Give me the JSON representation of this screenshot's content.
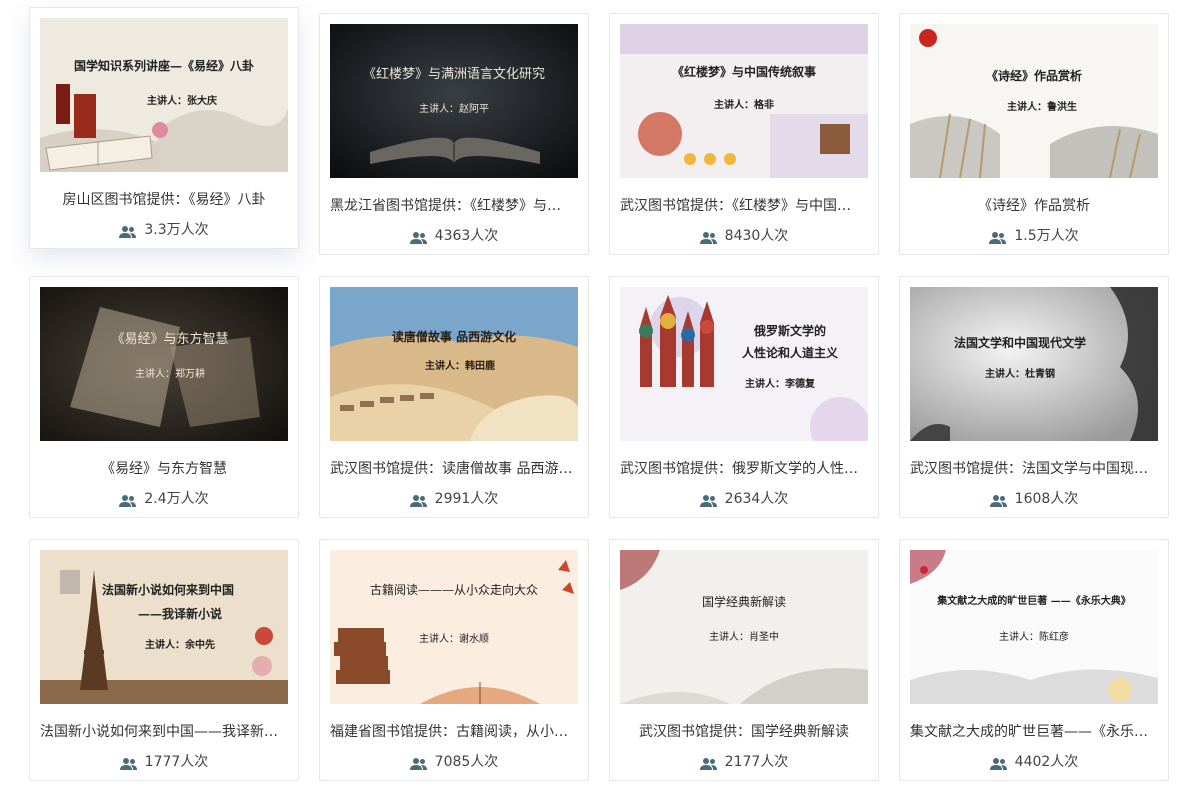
{
  "cards": [
    {
      "title": "房山区图书馆提供：《易经》八卦",
      "views": "3.3万人次",
      "thumb": {
        "line1": "国学知识系列讲座—《易经》八卦",
        "line2": "主讲人：张大庆"
      }
    },
    {
      "title": "黑龙江省图书馆提供：《红楼梦》与…",
      "views": "4363人次",
      "thumb": {
        "line1": "《红楼梦》与满洲语言文化研究",
        "line2": "主讲人：赵阿平"
      }
    },
    {
      "title": "武汉图书馆提供：《红楼梦》与中国…",
      "views": "8430人次",
      "thumb": {
        "line1": "《红楼梦》与中国传统叙事",
        "line2": "主讲人：格非"
      }
    },
    {
      "title": "《诗经》作品赏析",
      "views": "1.5万人次",
      "thumb": {
        "line1": "《诗经》作品赏析",
        "line2": "主讲人：鲁洪生"
      }
    },
    {
      "title": "《易经》与东方智慧",
      "views": "2.4万人次",
      "thumb": {
        "line1": "《易经》与东方智慧",
        "line2": "主讲人：郑万耕"
      }
    },
    {
      "title": "武汉图书馆提供：读唐僧故事 品西游…",
      "views": "2991人次",
      "thumb": {
        "line1": "读唐僧故事 品西游文化",
        "line2": "主讲人：韩田鹿"
      }
    },
    {
      "title": "武汉图书馆提供：俄罗斯文学的人性…",
      "views": "2634人次",
      "thumb": {
        "line1": "俄罗斯文学的",
        "line1b": "人性论和人道主义",
        "line2": "主讲人：李德复"
      }
    },
    {
      "title": "武汉图书馆提供：法国文学与中国现…",
      "views": "1608人次",
      "thumb": {
        "line1": "法国文学和中国现代文学",
        "line2": "主讲人：杜青钢"
      }
    },
    {
      "title": "法国新小说如何来到中国——我译新…",
      "views": "1777人次",
      "thumb": {
        "line1": "法国新小说如何来到中国",
        "line1b": "——我译新小说",
        "line2": "主讲人：余中先"
      }
    },
    {
      "title": "福建省图书馆提供：古籍阅读，从小…",
      "views": "7085人次",
      "thumb": {
        "line1": "古籍阅读———从小众走向大众",
        "line2": "主讲人：谢水顺"
      }
    },
    {
      "title": "武汉图书馆提供：国学经典新解读",
      "views": "2177人次",
      "thumb": {
        "line1": "国学经典新解读",
        "line2": "主讲人：肖圣中"
      }
    },
    {
      "title": "集文献之大成的旷世巨著——《永乐…",
      "views": "4402人次",
      "thumb": {
        "line1": "集文献之大成的旷世巨著 ——《永乐大典》",
        "line2": "主讲人：陈红彦"
      }
    }
  ],
  "icons": {
    "views": "people-icon"
  },
  "colors": {
    "icon": "#4a6b7a",
    "border": "#e6e6e6"
  }
}
